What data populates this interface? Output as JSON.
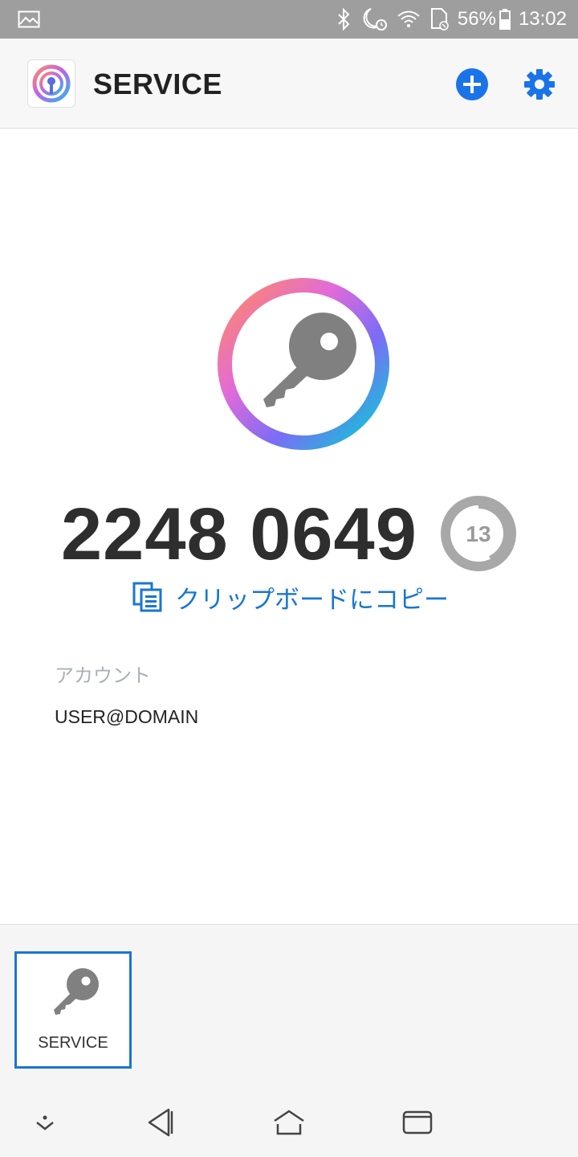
{
  "status_bar": {
    "battery": "56%",
    "time": "13:02",
    "icons": [
      "gallery-icon",
      "bluetooth-icon",
      "moon-alarm-icon",
      "wifi-icon",
      "sim-icon",
      "battery-icon"
    ]
  },
  "app_bar": {
    "title": "SERVICE",
    "actions": [
      "plus-circle-icon",
      "gear-icon"
    ],
    "accent_color": "#1a73e8"
  },
  "token": {
    "code": "2248 0649",
    "timer_seconds": "13",
    "timer_progress": 0.43,
    "copy_label": "クリップボードにコピー",
    "icon": "key-icon"
  },
  "account": {
    "label": "アカウント",
    "value": "USER@DOMAIN"
  },
  "tray": {
    "items": [
      {
        "label": "SERVICE",
        "icon": "key-icon",
        "selected": true
      }
    ]
  },
  "nav_bar": {
    "buttons": [
      "collapse-icon",
      "back-icon",
      "home-icon",
      "recents-icon"
    ]
  }
}
